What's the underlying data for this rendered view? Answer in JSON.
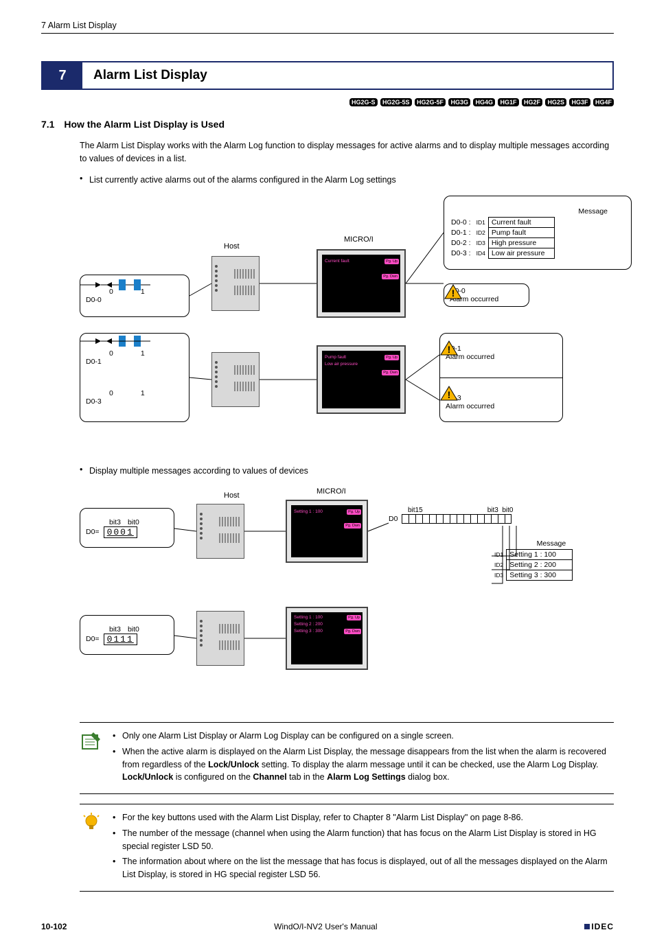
{
  "header": {
    "section": "7 Alarm List Display"
  },
  "chapter": {
    "num": "7",
    "title": "Alarm List Display"
  },
  "models": [
    "HG2G-S",
    "HG2G-5S",
    "HG2G-5F",
    "HG3G",
    "HG4G",
    "HG1F",
    "HG2F",
    "HG2S",
    "HG3F",
    "HG4F"
  ],
  "section": {
    "num": "7.1",
    "title": "How the Alarm List Display is Used"
  },
  "intro": "The Alarm List Display works with the Alarm Log function to display messages for active alarms and to display multiple messages according to values of devices in a list.",
  "bullet1": "List currently active alarms out of the alarms configured in the Alarm Log settings",
  "diagram1": {
    "host_label": "Host",
    "micro_label": "MICRO/I",
    "msg_header": "Message",
    "rows": [
      {
        "addr": "D0-0 :",
        "id": "ID1",
        "msg": "Current fault"
      },
      {
        "addr": "D0-1 :",
        "id": "ID2",
        "msg": "Pump fault"
      },
      {
        "addr": "D0-2 :",
        "id": "ID3",
        "msg": "High pressure"
      },
      {
        "addr": "D0-3 :",
        "id": "ID4",
        "msg": "Low air pressure"
      }
    ],
    "panel1_line": "Current fault",
    "panel2_line1": "Pump fault",
    "panel2_line2": "Low air pressure",
    "btn_up": "Pg. Up",
    "btn_dn": "Pg. Dwn",
    "switch0": "0",
    "switch1": "1",
    "sw_labels": [
      "D0-0",
      "D0-1",
      "D0-3"
    ],
    "alarm_text": "Alarm occurred",
    "alarm_labels": [
      "D0-0",
      "D0-1",
      "D0-3"
    ]
  },
  "bullet2": "Display multiple messages according to values of devices",
  "diagram2": {
    "host_label": "Host",
    "micro_label": "MICRO/I",
    "d0eq": "D0=",
    "bits_lbl3": "bit3",
    "bits_lbl0": "bit0",
    "bits_lbl15": "bit15",
    "d0_val1": "0001",
    "d0_val2": "0111",
    "d0_label": "D0",
    "panel1_line": "Setting 1 : 100",
    "panel2_l1": "Setting 1 : 100",
    "panel2_l2": "Setting 2 : 200",
    "panel2_l3": "Setting 3 : 300",
    "msg_header": "Message",
    "msgs": [
      {
        "id": "ID1",
        "msg": "Setting 1 : 100"
      },
      {
        "id": "ID2",
        "msg": "Setting 2 : 200"
      },
      {
        "id": "ID3",
        "msg": "Setting 3 : 300"
      }
    ]
  },
  "note1": {
    "b1": "Only one Alarm List Display or Alarm Log Display can be configured on a single screen.",
    "b2_pre": "When the active alarm is displayed on the Alarm List Display, the message disappears from the list when the alarm is recovered from regardless of the ",
    "b2_bold1": "Lock/Unlock",
    "b2_mid": " setting. To display the alarm message until it can be checked, use the Alarm Log Display. ",
    "b2_bold2": "Lock/Unlock",
    "b2_mid2": " is configured on the ",
    "b2_bold3": "Channel",
    "b2_mid3": " tab in the ",
    "b2_bold4": "Alarm Log Settings",
    "b2_end": " dialog box."
  },
  "note2": {
    "b1": "For the key buttons used with the Alarm List Display, refer to Chapter 8 \"Alarm List Display\" on page 8-86.",
    "b2": "The number of the message (channel when using the Alarm function) that has focus on the Alarm List Display is stored in HG special register LSD 50.",
    "b3": "The information about where on the list the message that has focus is displayed, out of all the messages displayed on the Alarm List Display, is stored in HG special register LSD 56."
  },
  "footer": {
    "page": "10-102",
    "manual": "WindO/I-NV2 User's Manual",
    "brand": "IDEC"
  }
}
